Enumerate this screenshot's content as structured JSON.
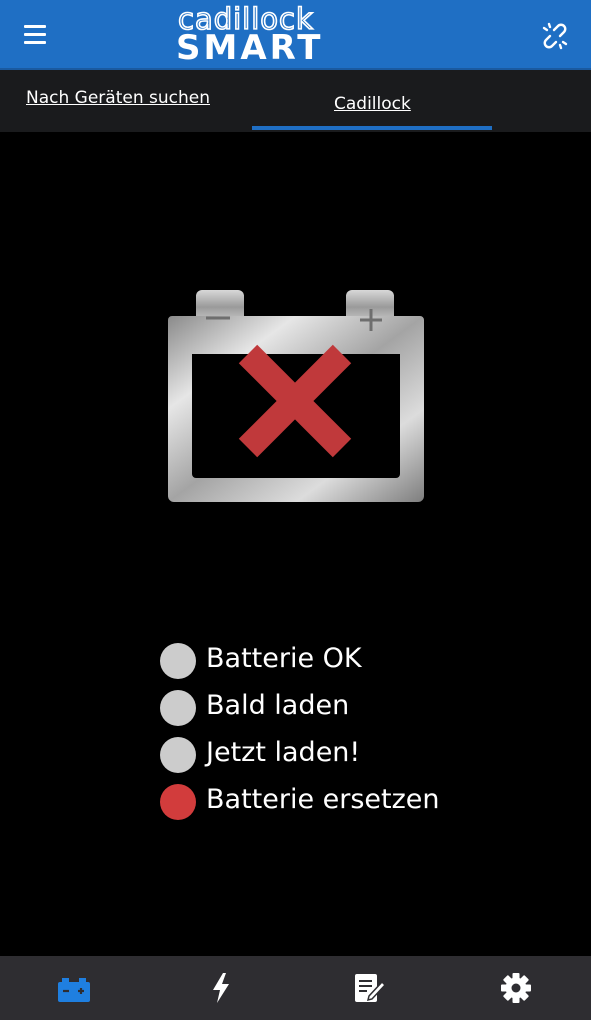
{
  "header": {
    "logo_top": "cadillock",
    "logo_bottom": "SMART"
  },
  "tabs": [
    {
      "label": "Nach Geräten suchen",
      "active": false
    },
    {
      "label": "Cadillock",
      "active": true
    }
  ],
  "battery": {
    "status_icon": "battery-error-x-icon",
    "minus_label": "−",
    "plus_label": "+"
  },
  "legend": [
    {
      "label": "Batterie OK",
      "color": "#cccccc",
      "active": false
    },
    {
      "label": "Bald laden",
      "color": "#cccccc",
      "active": false
    },
    {
      "label": "Jetzt laden!",
      "color": "#cccccc",
      "active": false
    },
    {
      "label": "Batterie ersetzen",
      "color": "#d23c3c",
      "active": true
    }
  ],
  "bottom_nav": [
    {
      "icon": "battery-icon",
      "active": true
    },
    {
      "icon": "lightning-icon",
      "active": false
    },
    {
      "icon": "notes-icon",
      "active": false
    },
    {
      "icon": "settings-gear-icon",
      "active": false
    }
  ],
  "colors": {
    "accent": "#1f6fc4",
    "error": "#c0393b",
    "inactive_dot": "#cccccc",
    "nav_bg": "#2e2d31"
  }
}
